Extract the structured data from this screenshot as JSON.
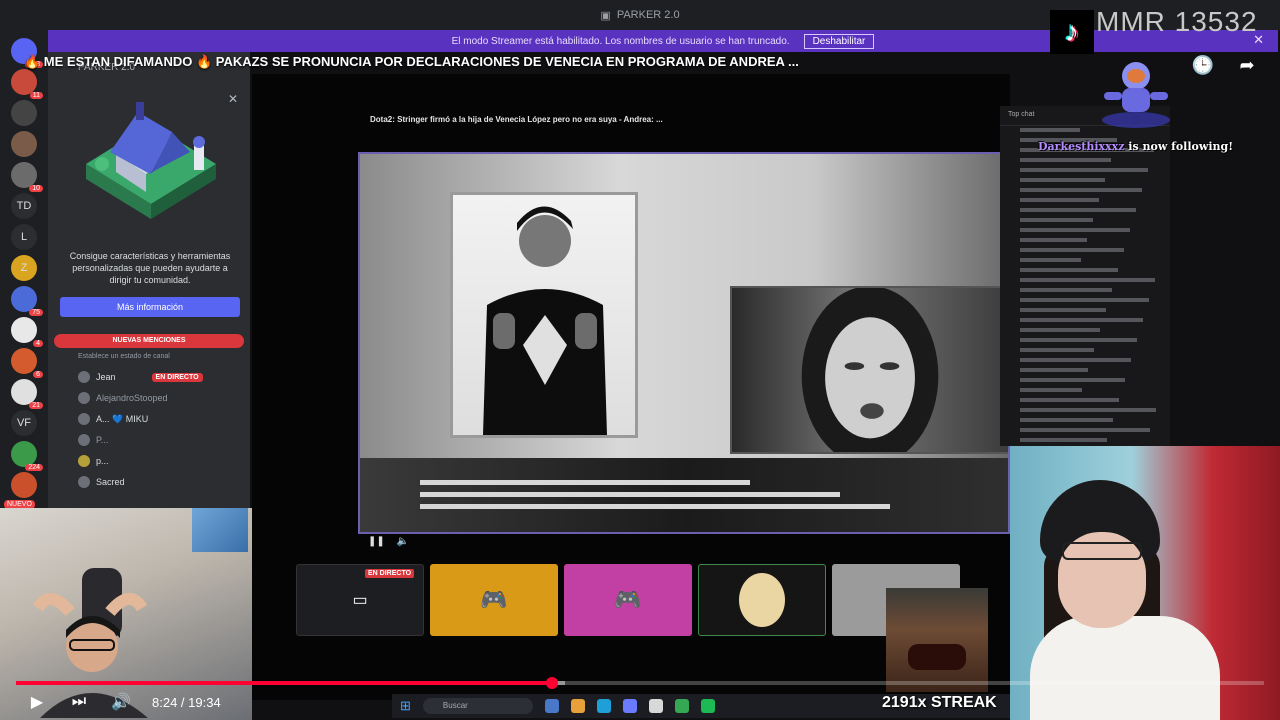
{
  "app": {
    "title": "PARKER 2.0"
  },
  "banner": {
    "text": "El modo Streamer está habilitado. Los nombres de usuario se han truncado.",
    "button": "Deshabilitar"
  },
  "video": {
    "title": "🔥 ME ESTAN DIFAMANDO 🔥 PAKAZS SE PRONUNCIA POR DECLARACIONES DE VENECIA EN PROGRAMA DE ANDREA ...",
    "time_current": "8:24",
    "time_total": "19:34",
    "progress": 0.4298,
    "buffered": 0.44
  },
  "guild_rail": {
    "items": [
      {
        "label": "",
        "badge": "138"
      },
      {
        "label": "",
        "badge": "11"
      },
      {
        "label": "",
        "badge": ""
      },
      {
        "label": "",
        "badge": ""
      },
      {
        "label": "",
        "badge": "10"
      },
      {
        "label": "TD",
        "badge": ""
      },
      {
        "label": "L",
        "badge": ""
      },
      {
        "label": "Z",
        "badge": ""
      },
      {
        "label": "",
        "badge": "75"
      },
      {
        "label": "",
        "badge": "4"
      },
      {
        "label": "",
        "badge": "6"
      },
      {
        "label": "",
        "badge": "21"
      },
      {
        "label": "VF",
        "badge": ""
      },
      {
        "label": "",
        "badge": "224"
      },
      {
        "label": "",
        "badge": ""
      }
    ],
    "new_label": "NUEVO"
  },
  "sidebar": {
    "title": "PARKER 2.0",
    "promo_text": "Consigue características y herramientas personalizadas que pueden ayudarte a dirigir tu comunidad.",
    "promo_button": "Más información",
    "mentions": "NUEVAS MENCIONES",
    "status_placeholder": "Establece un estado de canal",
    "members": [
      {
        "name": "Jean",
        "tag": "EN DIRECTO"
      },
      {
        "name": "AlejandroStooped",
        "tag": ""
      },
      {
        "name": "A... 💙 MIKU",
        "tag": ""
      },
      {
        "name": "P...",
        "tag": ""
      },
      {
        "name": "p...",
        "tag": ""
      },
      {
        "name": "Sacred",
        "tag": ""
      }
    ]
  },
  "stream": {
    "caption": "Dota2:  Stringer firmó a la hija de Venecia López pero no era suya - Andrea: ...",
    "tile_live": "EN DIRECTO",
    "taskbar_search": "Buscar"
  },
  "chat": {
    "header": "Top chat",
    "follow_user": "Darkesthixxxz",
    "follow_text": " is now following!"
  },
  "overlay": {
    "mmr": "MMR 13532",
    "streak": "2191x STREAK"
  },
  "colors": {
    "accent": "#5865f2",
    "banner": "#5a32c0",
    "progress": "#ff0033",
    "live": "#da373c"
  }
}
